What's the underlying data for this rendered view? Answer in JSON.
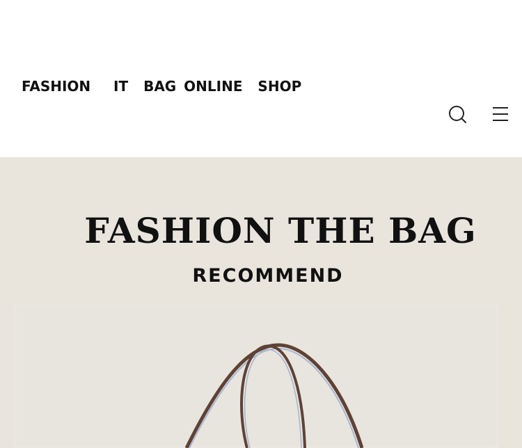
{
  "header": {
    "brand": "FASHION   IT  BAG ONLINE  SHOP",
    "search_icon": "search-icon",
    "menu_icon": "hamburger-menu-icon"
  },
  "hero": {
    "title": "FASHION THE BAG",
    "subtitle": "RECOMMEND",
    "product_image": "tote-bag-handles"
  },
  "colors": {
    "header_bg": "#ffffff",
    "hero_bg": "#e9e5dd",
    "text": "#111111",
    "handle_brown": "#6b4a3e",
    "handle_blue": "#8fa0c0"
  }
}
